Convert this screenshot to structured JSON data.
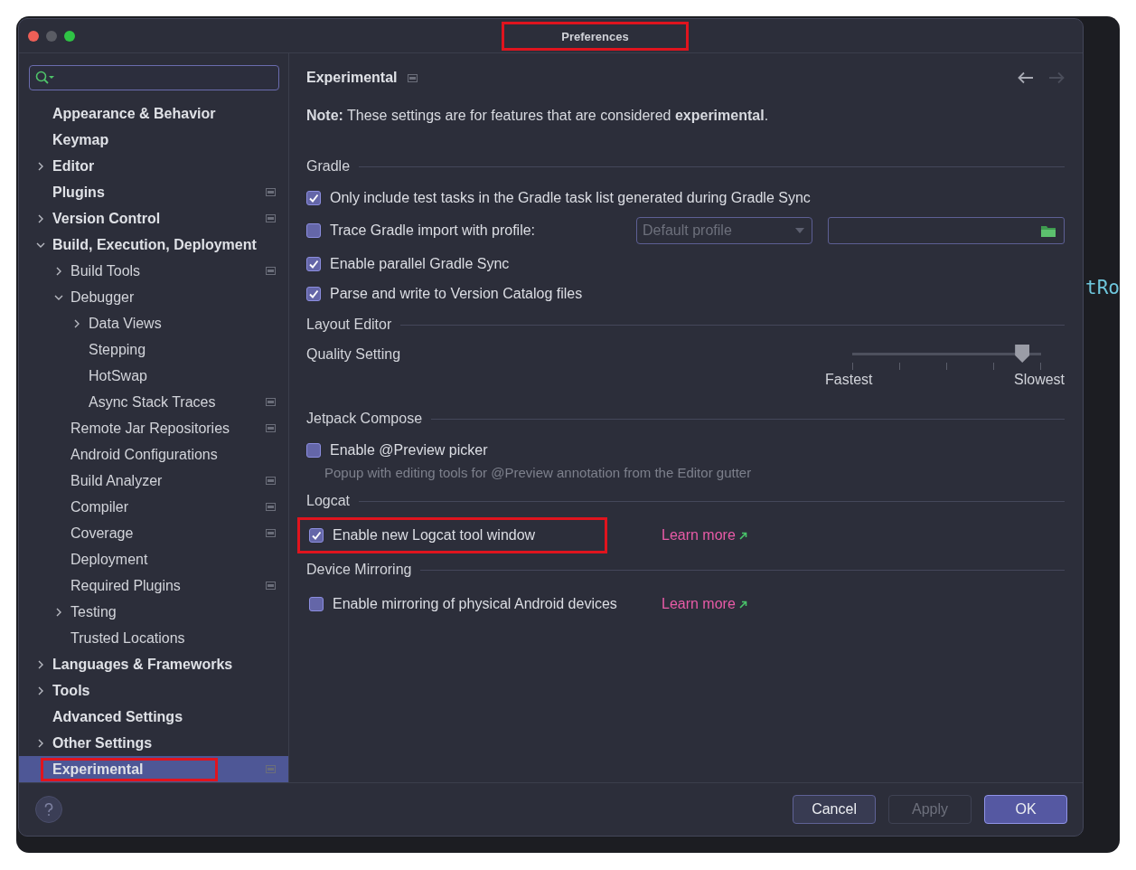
{
  "window": {
    "title": "Preferences",
    "highlighted": true
  },
  "sidebar": {
    "items": [
      {
        "label": "Appearance & Behavior",
        "kind": "page",
        "scoped": false,
        "selected": false,
        "highlighted": false
      },
      {
        "label": "Keymap",
        "kind": "page",
        "scoped": false,
        "selected": false,
        "highlighted": false
      },
      {
        "label": "Editor",
        "kind": "group",
        "expanded": false,
        "scoped": false,
        "selected": false,
        "highlighted": false
      },
      {
        "label": "Plugins",
        "kind": "page",
        "scoped": true,
        "selected": false,
        "highlighted": false
      },
      {
        "label": "Version Control",
        "kind": "group",
        "expanded": false,
        "scoped": true,
        "selected": false,
        "highlighted": false
      },
      {
        "label": "Build, Execution, Deployment",
        "kind": "group",
        "expanded": true,
        "scoped": false,
        "selected": false,
        "highlighted": false,
        "children": [
          {
            "label": "Build Tools",
            "kind": "group",
            "expanded": false,
            "scoped": true,
            "selected": false,
            "highlighted": false
          },
          {
            "label": "Debugger",
            "kind": "group",
            "expanded": true,
            "scoped": false,
            "selected": false,
            "highlighted": false,
            "children": [
              {
                "label": "Data Views",
                "kind": "group",
                "expanded": false,
                "scoped": false,
                "selected": false,
                "highlighted": false
              },
              {
                "label": "Stepping",
                "kind": "page",
                "scoped": false,
                "selected": false,
                "highlighted": false
              },
              {
                "label": "HotSwap",
                "kind": "page",
                "scoped": false,
                "selected": false,
                "highlighted": false
              },
              {
                "label": "Async Stack Traces",
                "kind": "page",
                "scoped": true,
                "selected": false,
                "highlighted": false
              }
            ]
          },
          {
            "label": "Remote Jar Repositories",
            "kind": "page",
            "scoped": true,
            "selected": false,
            "highlighted": false
          },
          {
            "label": "Android Configurations",
            "kind": "page",
            "scoped": false,
            "selected": false,
            "highlighted": false
          },
          {
            "label": "Build Analyzer",
            "kind": "page",
            "scoped": true,
            "selected": false,
            "highlighted": false
          },
          {
            "label": "Compiler",
            "kind": "page",
            "scoped": true,
            "selected": false,
            "highlighted": false
          },
          {
            "label": "Coverage",
            "kind": "page",
            "scoped": true,
            "selected": false,
            "highlighted": false
          },
          {
            "label": "Deployment",
            "kind": "page",
            "scoped": false,
            "selected": false,
            "highlighted": false
          },
          {
            "label": "Required Plugins",
            "kind": "page",
            "scoped": true,
            "selected": false,
            "highlighted": false
          },
          {
            "label": "Testing",
            "kind": "group",
            "expanded": false,
            "scoped": false,
            "selected": false,
            "highlighted": false
          },
          {
            "label": "Trusted Locations",
            "kind": "page",
            "scoped": false,
            "selected": false,
            "highlighted": false
          }
        ]
      },
      {
        "label": "Languages & Frameworks",
        "kind": "group",
        "expanded": false,
        "scoped": false,
        "selected": false,
        "highlighted": false
      },
      {
        "label": "Tools",
        "kind": "group",
        "expanded": false,
        "scoped": false,
        "selected": false,
        "highlighted": false
      },
      {
        "label": "Advanced Settings",
        "kind": "page",
        "scoped": false,
        "selected": false,
        "highlighted": false
      },
      {
        "label": "Other Settings",
        "kind": "group",
        "expanded": false,
        "scoped": false,
        "selected": false,
        "highlighted": false
      },
      {
        "label": "Experimental",
        "kind": "page",
        "scoped": true,
        "selected": true,
        "highlighted": true
      }
    ]
  },
  "content": {
    "title": "Experimental",
    "nav": {
      "back_disabled": false,
      "forward_disabled": true
    },
    "note": "**Note:** These settings are for features that are considered **experimental**.",
    "sections": [
      {
        "title": "Gradle",
        "rows": [
          {
            "kind": "checkbox",
            "label": "Only include test tasks in the Gradle task list generated during Gradle Sync",
            "checked": true
          },
          {
            "kind": "profile",
            "label": "Trace Gradle import with profile:",
            "checked": false,
            "dropdown": {
              "value": "Default profile",
              "disabled": true
            }
          },
          {
            "kind": "checkbox",
            "label": "Enable parallel Gradle Sync",
            "checked": true
          },
          {
            "kind": "checkbox",
            "label": "Parse and write to Version Catalog files",
            "checked": true
          }
        ]
      },
      {
        "title": "Layout Editor",
        "rows": [
          {
            "kind": "slider",
            "label": "Quality Setting",
            "level": 0.9,
            "min_label": "Fastest",
            "max_label": "Slowest"
          }
        ]
      },
      {
        "title": "Jetpack Compose",
        "rows": [
          {
            "kind": "checkbox",
            "label": "Enable @Preview picker",
            "checked": false,
            "hint": "Popup with editing tools for @Preview annotation from the Editor gutter"
          }
        ]
      },
      {
        "title": "Logcat",
        "rows": [
          {
            "kind": "checkbox",
            "label": "Enable new Logcat tool window",
            "checked": true,
            "highlighted": true,
            "link": "Learn more"
          }
        ]
      },
      {
        "title": "Device Mirroring",
        "rows": [
          {
            "kind": "checkbox",
            "label": "Enable mirroring of physical Android devices",
            "checked": false,
            "highlighted": false,
            "link": "Learn more"
          }
        ]
      }
    ]
  },
  "footer": {
    "buttons": [
      {
        "label": "Cancel",
        "kind": "secondary",
        "disabled": false
      },
      {
        "label": "Apply",
        "kind": "secondary",
        "disabled": true
      },
      {
        "label": "OK",
        "kind": "primary",
        "disabled": false
      }
    ]
  },
  "backdrop": {
    "code_text": "tRo"
  }
}
